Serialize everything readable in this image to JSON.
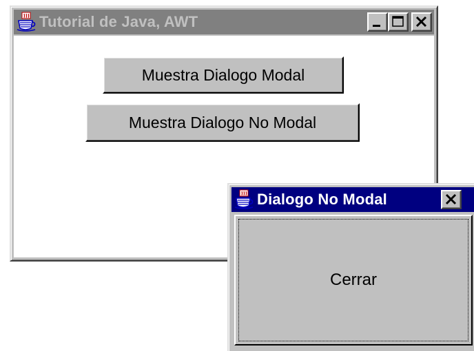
{
  "main_window": {
    "title": "Tutorial de Java, AWT",
    "icon": "java-coffee-cup-icon",
    "state": "inactive",
    "caption_buttons": [
      "minimize-icon",
      "maximize-icon",
      "close-icon"
    ],
    "buttons": {
      "modal": "Muestra Dialogo Modal",
      "non_modal": "Muestra Dialogo No Modal"
    }
  },
  "dialog": {
    "title": "Dialogo No Modal",
    "icon": "java-coffee-cup-icon",
    "state": "active",
    "caption_buttons": [
      "close-icon"
    ],
    "close_button_label": "Cerrar"
  },
  "colors": {
    "active_title": "#000080",
    "inactive_title": "#808080",
    "face": "#c0c0c0"
  }
}
